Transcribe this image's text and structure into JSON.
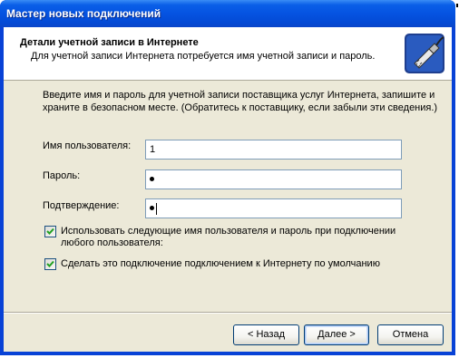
{
  "window": {
    "title": "Мастер новых подключений"
  },
  "header": {
    "title": "Детали учетной записи в Интернете",
    "subtitle": "Для учетной записи Интернета потребуется имя учетной записи и пароль."
  },
  "intro": "Введите имя и пароль для учетной записи поставщика услуг Интернета, запишите и храните в безопасном месте. (Обратитесь к поставщику, если забыли эти сведения.)",
  "fields": {
    "username": {
      "label": "Имя пользователя:",
      "value": "1"
    },
    "password": {
      "label": "Пароль:",
      "masked_length": 1
    },
    "confirm": {
      "label": "Подтверждение:",
      "masked_length": 1
    }
  },
  "options": {
    "use_for_all_users": {
      "label": "Использовать следующие имя пользователя и пароль при подключении любого пользователя:",
      "checked": true
    },
    "default_connection": {
      "label": "Сделать это подключение подключением к Интернету по умолчанию",
      "checked": true
    }
  },
  "buttons": {
    "back": "< Назад",
    "next": "Далее >",
    "cancel": "Отмена"
  },
  "colors": {
    "titlebar": "#0553e1",
    "face": "#ece9d8",
    "checkmark": "#21a121",
    "input_border": "#7f9db9"
  }
}
